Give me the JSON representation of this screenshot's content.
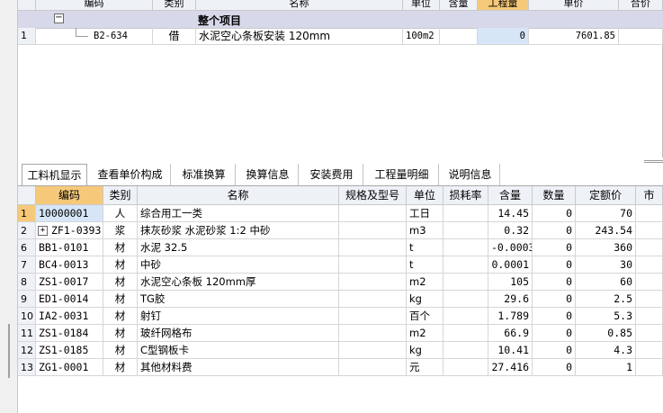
{
  "top_grid": {
    "headers": {
      "code": "编码",
      "category": "类别",
      "name": "名称",
      "unit": "单位",
      "content": "含量",
      "quantity": "工程量",
      "price": "单价",
      "total": "合价"
    },
    "group_label": "整个项目",
    "row": {
      "num": "1",
      "code": "B2-634",
      "category": "借",
      "name": "水泥空心条板安装 120mm",
      "unit": "100m2",
      "quantity": "0",
      "price": "7601.85"
    }
  },
  "tabs": [
    "工料机显示",
    "查看单价构成",
    "标准换算",
    "换算信息",
    "安装费用",
    "工程量明细",
    "说明信息"
  ],
  "bottom_grid": {
    "headers": {
      "code": "编码",
      "category": "类别",
      "name": "名称",
      "spec": "规格及型号",
      "unit": "单位",
      "loss": "损耗率",
      "content": "含量",
      "count": "数量",
      "price": "定额价",
      "extra": "市"
    },
    "rows": [
      {
        "num": "1",
        "code": "10000001",
        "category": "人",
        "name": "综合用工一类",
        "unit": "工日",
        "content": "14.45",
        "count": "0",
        "price": "70"
      },
      {
        "num": "2",
        "code": "ZF1-0393",
        "category": "浆",
        "name": "抹灰砂浆 水泥砂浆 1:2 中砂",
        "unit": "m3",
        "content": "0.32",
        "count": "0",
        "price": "243.54"
      },
      {
        "num": "6",
        "code": "BB1-0101",
        "category": "材",
        "name": "水泥 32.5",
        "unit": "t",
        "content": "-0.0003",
        "count": "0",
        "price": "360"
      },
      {
        "num": "7",
        "code": "BC4-0013",
        "category": "材",
        "name": "中砂",
        "unit": "t",
        "content": "0.0001",
        "count": "0",
        "price": "30"
      },
      {
        "num": "8",
        "code": "ZS1-0017",
        "category": "材",
        "name": "水泥空心条板 120mm厚",
        "unit": "m2",
        "content": "105",
        "count": "0",
        "price": "60"
      },
      {
        "num": "9",
        "code": "ED1-0014",
        "category": "材",
        "name": "TG胶",
        "unit": "kg",
        "content": "29.6",
        "count": "0",
        "price": "2.5"
      },
      {
        "num": "10",
        "code": "IA2-0031",
        "category": "材",
        "name": "射钉",
        "unit": "百个",
        "content": "1.789",
        "count": "0",
        "price": "5.3"
      },
      {
        "num": "11",
        "code": "ZS1-0184",
        "category": "材",
        "name": "玻纤网格布",
        "unit": "m2",
        "content": "66.9",
        "count": "0",
        "price": "0.85"
      },
      {
        "num": "12",
        "code": "ZS1-0185",
        "category": "材",
        "name": "C型钢板卡",
        "unit": "kg",
        "content": "10.41",
        "count": "0",
        "price": "4.3"
      },
      {
        "num": "13",
        "code": "ZG1-0001",
        "category": "材",
        "name": "其他材料费",
        "unit": "元",
        "content": "27.416",
        "count": "0",
        "price": "1"
      }
    ]
  },
  "colors": {
    "header_bg": "#eef2f7",
    "header_highlight": "#f6c97a",
    "group_bg": "#d7d8e9",
    "selected_cell": "#d6e6f7"
  }
}
